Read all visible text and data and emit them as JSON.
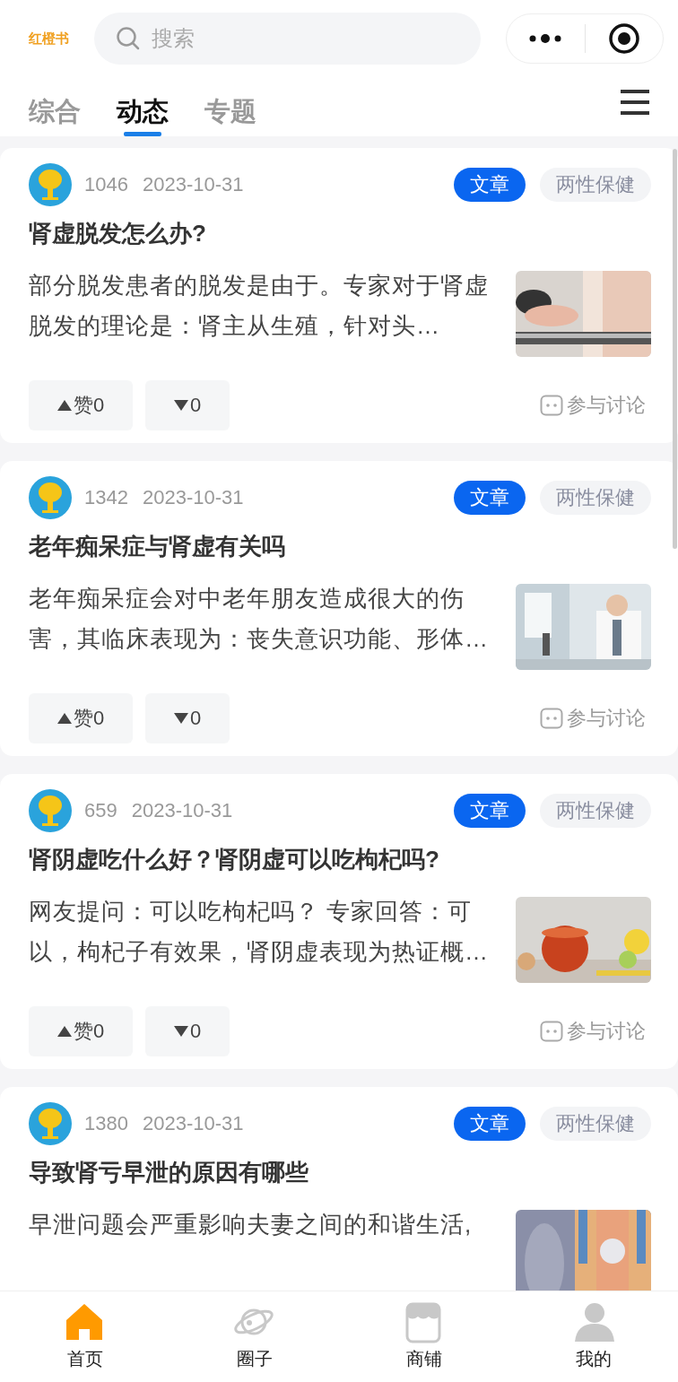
{
  "header": {
    "logo": "红橙书",
    "search": {
      "placeholder": "搜索"
    }
  },
  "tabs": [
    {
      "label": "综合",
      "selected": false
    },
    {
      "label": "动态",
      "selected": true
    },
    {
      "label": "专题",
      "selected": false
    }
  ],
  "posts": [
    {
      "views": "1046",
      "date": "2023-10-31",
      "type_tag": "文章",
      "category_tag": "两性保健",
      "title": "肾虚脱发怎么办?",
      "summary": "部分脱发患者的脱发是由于。专家对于肾虚脱发的理论是：肾主从生殖，针对头…",
      "like": "赞0",
      "dislike": "0",
      "discuss": "参与讨论"
    },
    {
      "views": "1342",
      "date": "2023-10-31",
      "type_tag": "文章",
      "category_tag": "两性保健",
      "title": "老年痴呆症与肾虚有关吗",
      "summary": "老年痴呆症会对中老年朋友造成很大的伤害，其临床表现为：丧失意识功能、形体…",
      "like": "赞0",
      "dislike": "0",
      "discuss": "参与讨论"
    },
    {
      "views": "659",
      "date": "2023-10-31",
      "type_tag": "文章",
      "category_tag": "两性保健",
      "title": "肾阴虚吃什么好？肾阴虚可以吃枸杞吗?",
      "summary": "网友提问：可以吃枸杞吗？ 专家回答：可以，枸杞子有效果，肾阴虚表现为热证概…",
      "like": "赞0",
      "dislike": "0",
      "discuss": "参与讨论"
    },
    {
      "views": "1380",
      "date": "2023-10-31",
      "type_tag": "文章",
      "category_tag": "两性保健",
      "title": "导致肾亏早泄的原因有哪些",
      "summary": "早泄问题会严重影响夫妻之间的和谐生活,"
    }
  ],
  "bottom_nav": [
    {
      "label": "首页",
      "selected": true
    },
    {
      "label": "圈子",
      "selected": false
    },
    {
      "label": "商铺",
      "selected": false
    },
    {
      "label": "我的",
      "selected": false
    }
  ]
}
